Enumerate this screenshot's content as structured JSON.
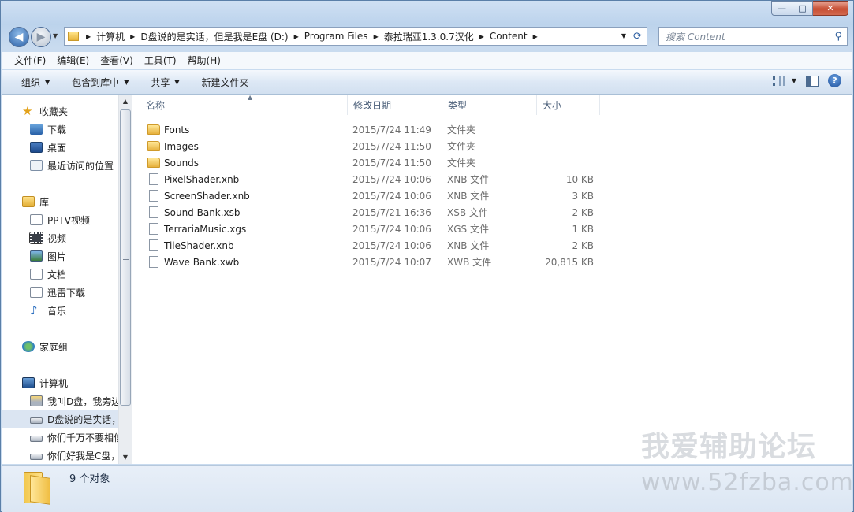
{
  "window": {
    "controls": {
      "minimize": "—",
      "maximize": "□",
      "close": "✕"
    }
  },
  "address": {
    "segments": [
      "计算机",
      "D盘说的是实话，但是我是E盘 (D:)",
      "Program Files",
      "泰拉瑞亚1.3.0.7汉化",
      "Content"
    ]
  },
  "search": {
    "placeholder": "搜索 Content"
  },
  "menu": [
    "文件(F)",
    "编辑(E)",
    "查看(V)",
    "工具(T)",
    "帮助(H)"
  ],
  "toolbar": {
    "organize": "组织",
    "include_library": "包含到库中",
    "share": "共享",
    "new_folder": "新建文件夹"
  },
  "sidebar": {
    "favorites": "收藏夹",
    "downloads": "下载",
    "desktop": "桌面",
    "recent": "最近访问的位置",
    "libraries": "库",
    "pptv": "PPTV视频",
    "videos": "视频",
    "pictures": "图片",
    "documents": "文档",
    "xunlei": "迅雷下载",
    "music": "音乐",
    "homegroup": "家庭组",
    "computer": "计算机",
    "drive_c": "我叫D盘，我旁边",
    "drive_d": "D盘说的是实话，",
    "drive_e": "你们千万不要相信",
    "drive_f": "你们好我是C盘，"
  },
  "columns": {
    "name": "名称",
    "date": "修改日期",
    "type": "类型",
    "size": "大小"
  },
  "files": [
    {
      "name": "Fonts",
      "date": "2015/7/24 11:49",
      "type": "文件夹",
      "size": "",
      "kind": "folder"
    },
    {
      "name": "Images",
      "date": "2015/7/24 11:50",
      "type": "文件夹",
      "size": "",
      "kind": "folder"
    },
    {
      "name": "Sounds",
      "date": "2015/7/24 11:50",
      "type": "文件夹",
      "size": "",
      "kind": "folder"
    },
    {
      "name": "PixelShader.xnb",
      "date": "2015/7/24 10:06",
      "type": "XNB 文件",
      "size": "10 KB",
      "kind": "file"
    },
    {
      "name": "ScreenShader.xnb",
      "date": "2015/7/24 10:06",
      "type": "XNB 文件",
      "size": "3 KB",
      "kind": "file"
    },
    {
      "name": "Sound Bank.xsb",
      "date": "2015/7/21 16:36",
      "type": "XSB 文件",
      "size": "2 KB",
      "kind": "file"
    },
    {
      "name": "TerrariaMusic.xgs",
      "date": "2015/7/24 10:06",
      "type": "XGS 文件",
      "size": "1 KB",
      "kind": "file"
    },
    {
      "name": "TileShader.xnb",
      "date": "2015/7/24 10:06",
      "type": "XNB 文件",
      "size": "2 KB",
      "kind": "file"
    },
    {
      "name": "Wave Bank.xwb",
      "date": "2015/7/24 10:07",
      "type": "XWB 文件",
      "size": "20,815 KB",
      "kind": "file"
    }
  ],
  "status": {
    "count": "9 个对象"
  },
  "watermark": {
    "line1": "我爱辅助论坛",
    "line2": "www.52fzba.com"
  }
}
